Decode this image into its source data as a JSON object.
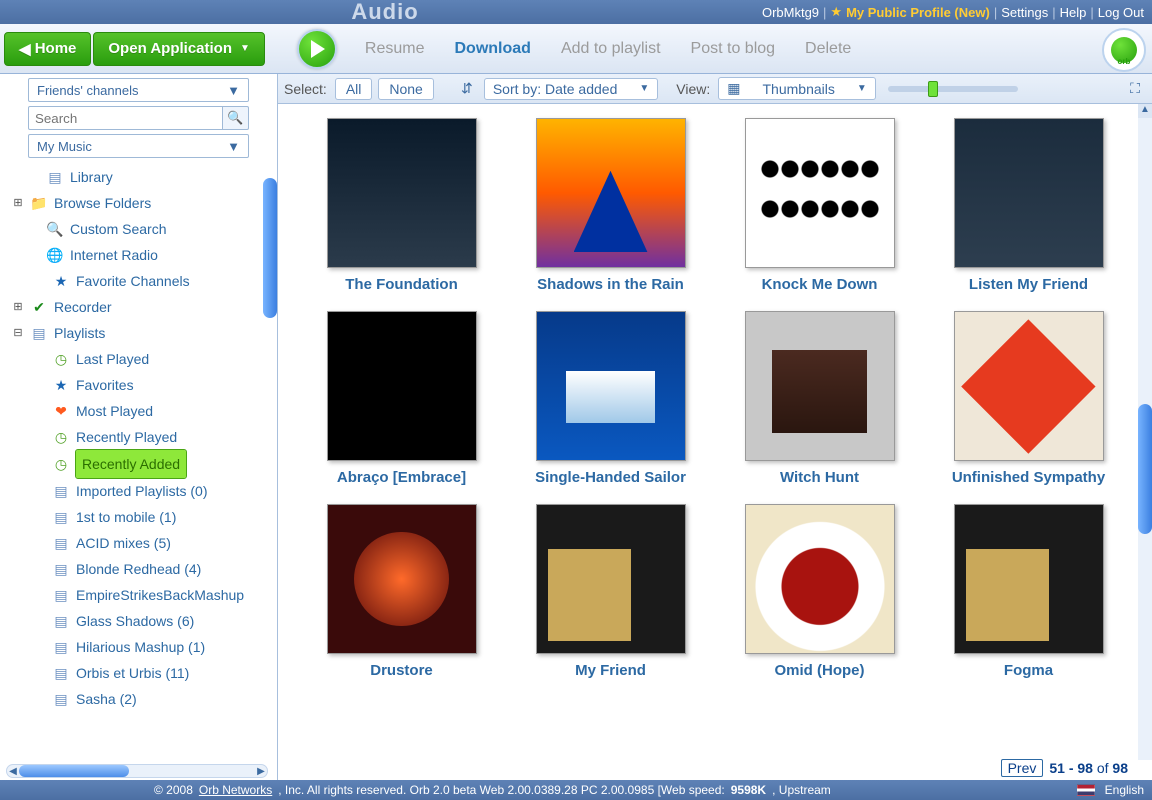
{
  "topbar": {
    "title": "Audio",
    "user": "OrbMktg9",
    "profile": "My Public Profile (New)",
    "settings": "Settings",
    "help": "Help",
    "logout": "Log Out"
  },
  "header": {
    "home": "Home",
    "open_app": "Open Application",
    "actions": {
      "resume": "Resume",
      "download": "Download",
      "add": "Add to playlist",
      "post": "Post to blog",
      "delete": "Delete"
    }
  },
  "filter": {
    "select_label": "Select:",
    "all": "All",
    "none": "None",
    "sort_label": "Sort by: Date added",
    "view_label": "View:",
    "view_value": "Thumbnails"
  },
  "sidebar": {
    "friends": "Friends' channels",
    "search_placeholder": "Search",
    "mymusic": "My Music",
    "items": [
      {
        "label": "Library"
      },
      {
        "label": "Browse Folders"
      },
      {
        "label": "Custom Search"
      },
      {
        "label": "Internet Radio"
      },
      {
        "label": "Favorite Channels"
      },
      {
        "label": "Recorder"
      },
      {
        "label": "Playlists"
      },
      {
        "label": "Last Played"
      },
      {
        "label": "Favorites"
      },
      {
        "label": "Most Played"
      },
      {
        "label": "Recently Played"
      },
      {
        "label": "Recently Added"
      },
      {
        "label": "Imported Playlists (0)"
      },
      {
        "label": "1st to mobile (1)"
      },
      {
        "label": "ACID mixes (5)"
      },
      {
        "label": "Blonde Redhead (4)"
      },
      {
        "label": "EmpireStrikesBackMashup"
      },
      {
        "label": "Glass Shadows (6)"
      },
      {
        "label": "Hilarious Mashup (1)"
      },
      {
        "label": "Orbis et Urbis (11)"
      },
      {
        "label": "Sasha (2)"
      }
    ]
  },
  "albums": [
    {
      "title": "The Foundation"
    },
    {
      "title": "Shadows in the Rain"
    },
    {
      "title": "Knock Me Down"
    },
    {
      "title": "Listen My Friend"
    },
    {
      "title": "Abraço [Embrace]"
    },
    {
      "title": "Single-Handed Sailor"
    },
    {
      "title": "Witch Hunt"
    },
    {
      "title": "Unfinished Sympathy"
    },
    {
      "title": "Drustore"
    },
    {
      "title": "My Friend"
    },
    {
      "title": "Omid (Hope)"
    },
    {
      "title": "Fogma"
    }
  ],
  "pager": {
    "prev": "Prev",
    "range": "51 - 98",
    "of": "of",
    "total": "98"
  },
  "status": {
    "copyright": "© 2008",
    "company": "Orb Networks",
    "rest": ", Inc. All rights reserved. Orb 2.0 beta  Web 2.00.0389.28  PC 2.00.0985  [Web speed:",
    "speed": "9598K",
    "tail": ", Upstream",
    "lang": "English"
  }
}
